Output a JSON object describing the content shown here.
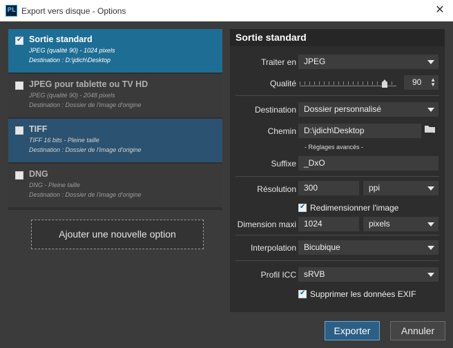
{
  "window": {
    "app_icon_text": "PL",
    "title": "Export vers disque - Options",
    "close_glyph": "✕"
  },
  "options": [
    {
      "name": "Sortie standard",
      "line1": "JPEG (qualité 90)  -  1024 pixels",
      "line2": "Destination : D:\\jdich\\Desktop",
      "checked": true,
      "selected": true
    },
    {
      "name": "JPEG pour tablette ou TV HD",
      "line1": "JPEG (qualité 90)  -  2048 pixels",
      "line2": "Destination : Dossier de l'image d'origine",
      "checked": false
    },
    {
      "name": "TIFF",
      "line1": "TIFF 16 bits  -  Pleine taille",
      "line2": "Destination : Dossier de l'image d'origine",
      "checked": false
    },
    {
      "name": "DNG",
      "line1": "DNG  -  Pleine taille",
      "line2": "Destination : Dossier de l'image d'origine",
      "checked": false
    }
  ],
  "add_option_label": "Ajouter une nouvelle option",
  "settings": {
    "header": "Sortie standard",
    "traiter_en": {
      "label": "Traiter en",
      "value": "JPEG"
    },
    "qualite": {
      "label": "Qualité",
      "value": "90",
      "slider_fraction": 0.9
    },
    "destination": {
      "label": "Destination",
      "value": "Dossier personnalisé"
    },
    "chemin": {
      "label": "Chemin",
      "value": "D:\\jdich\\Desktop"
    },
    "advanced_label": "- Réglages avancés -",
    "suffixe": {
      "label": "Suffixe",
      "value": "_DxO"
    },
    "resolution": {
      "label": "Résolution",
      "value": "300",
      "unit": "ppi"
    },
    "redimensionner": {
      "label": "Redimensionner l'image",
      "checked": true
    },
    "dimension_maxi": {
      "label": "Dimension maxi",
      "value": "1024",
      "unit": "pixels"
    },
    "interpolation": {
      "label": "Interpolation",
      "value": "Bicubique"
    },
    "profil_icc": {
      "label": "Profil ICC",
      "value": "sRVB"
    },
    "supprimer_exif": {
      "label": "Supprimer les données EXIF",
      "checked": true
    }
  },
  "buttons": {
    "export": "Exporter",
    "cancel": "Annuler"
  },
  "colors": {
    "accent": "#1e6d94",
    "export_button": "#2c5f86",
    "background": "#3b3b3b"
  }
}
